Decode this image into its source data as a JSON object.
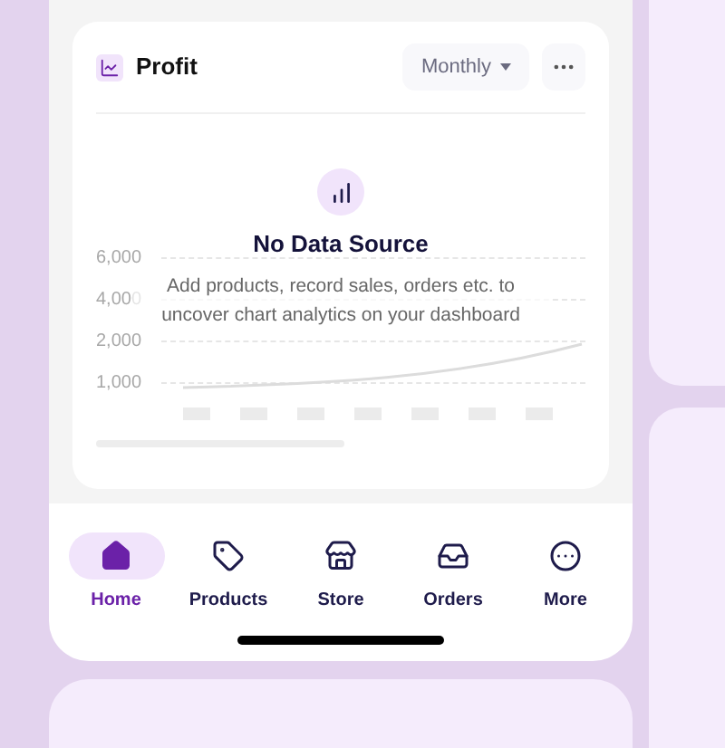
{
  "card": {
    "title": "Profit",
    "period": "Monthly",
    "empty_state": {
      "title": "No Data Source",
      "message": "Add products, record sales, orders etc. to uncover chart analytics on your dashboard"
    },
    "axis_labels": [
      "6,000",
      "4,000",
      "2,000",
      "1,000"
    ]
  },
  "nav": [
    {
      "label": "Home",
      "kind": "home",
      "selected": true
    },
    {
      "label": "Products",
      "kind": "tag",
      "selected": false
    },
    {
      "label": "Store",
      "kind": "store",
      "selected": false
    },
    {
      "label": "Orders",
      "kind": "inbox",
      "selected": false
    },
    {
      "label": "More",
      "kind": "more",
      "selected": false
    }
  ]
}
